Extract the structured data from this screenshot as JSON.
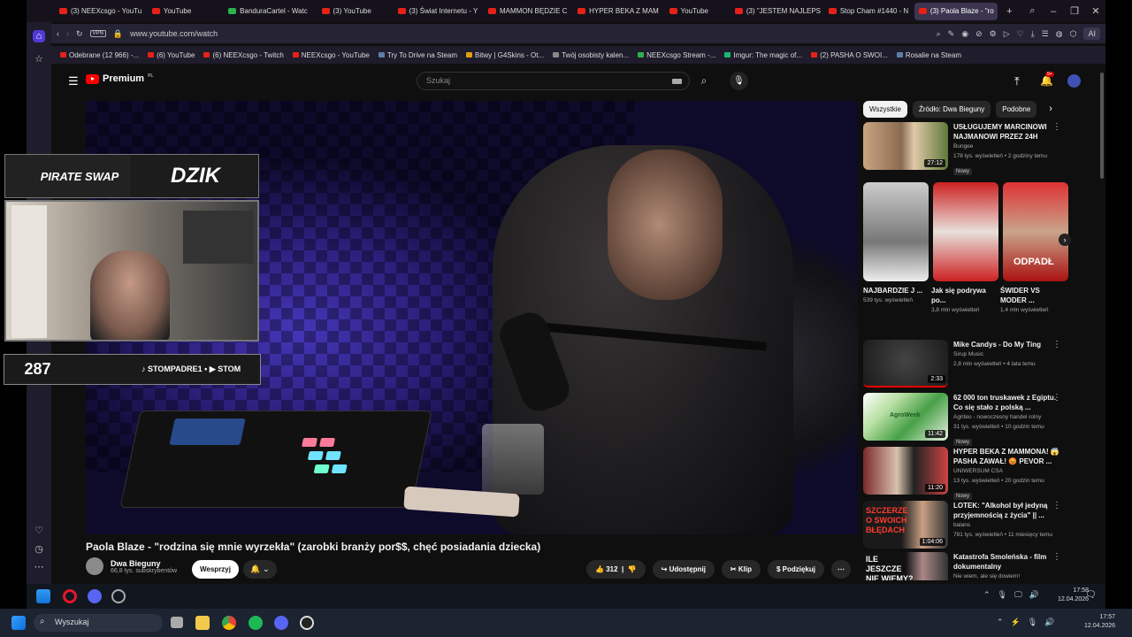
{
  "browser": {
    "tabs": [
      {
        "label": "(3) NEEXcsgo - YouTu",
        "fav": "youtube"
      },
      {
        "label": "YouTube",
        "fav": "youtube"
      },
      {
        "label": "BandurаCartel - Watc",
        "fav": "kick"
      },
      {
        "label": "(3) YouTube",
        "fav": "youtube"
      },
      {
        "label": "(3) Świat Internetu - Y",
        "fav": "youtube"
      },
      {
        "label": "MAMMON BĘDZIE C",
        "fav": "youtube"
      },
      {
        "label": "HYPER BEKA Z MAM",
        "fav": "youtube"
      },
      {
        "label": "YouTube",
        "fav": "youtube"
      },
      {
        "label": "(3) \"JESTEM NAJLEPS",
        "fav": "youtube"
      },
      {
        "label": "Stop Cham #1440 - N",
        "fav": "youtube"
      },
      {
        "label": "(3) Paola Blaze - \"ro",
        "fav": "youtube",
        "active": true
      }
    ],
    "url": "www.youtube.com/watch",
    "vpn_label": "VPN",
    "ai_label": "AI",
    "bookmarks": [
      "Odebrane (12 966) -...",
      "(6) YouTube",
      "(6) NEEXcsgo - Twitch",
      "NEEXcsgo - YouTube",
      "Try To Drive na Steam",
      "Bitwy | G4Skins - Ot...",
      "Twój osobisty kalen...",
      "NEEXcsgo Stream -...",
      "Imgur: The magic of...",
      "(2) PASHA O SWOI...",
      "Rosalie na Steam"
    ]
  },
  "youtube": {
    "logo_text": "Premium",
    "logo_region": "PL",
    "search_placeholder": "Szukaj",
    "notification_count": "9+",
    "video_title": "Paola Blaze - \"rodzina się mnie wyrzekła\" (zarobki branży por$$, chęć posiadania dziecka)",
    "channel_name": "Dwa Bieguny",
    "channel_subs": "66,8 tys. subskrybentów",
    "join_label": "Wesprzyj",
    "bell_label": "🔔 ⌄",
    "actions": {
      "likes": "312",
      "share": "Udostępnij",
      "clip": "Klip",
      "thanks": "Podziękuj"
    },
    "chips": [
      "Wszystkie",
      "Źródło: Dwa Bieguny",
      "Podobne"
    ],
    "recommendations": [
      {
        "title": "USŁUGUJEMY MARCINOWI NAJMANOWI PRZEZ 24H",
        "channel": "Bungee",
        "meta": "178 tys. wyświetleń • 2 godziny temu",
        "duration": "27:12",
        "badge": "Nowy"
      },
      {
        "title": "Mike Candys - Do My Ting",
        "channel": "Sirup Music",
        "meta": "2,8 mln wyświetleń • 4 lata temu",
        "duration": "2:33",
        "badge": ""
      },
      {
        "title": "62 000 ton truskawek z Egiptu. Co się stało z polską ...",
        "channel": "Agriteo - nowoczesny handel rolny",
        "meta": "31 tys. wyświetleń • 10 godzin temu",
        "duration": "11:42",
        "badge": "Nowy"
      },
      {
        "title": "HYPER BEKA Z MAMMONA! 😱 PASHA ZAWAŁ! 😡 PEVOR ...",
        "channel": "UNIWERSUM CSA",
        "meta": "13 tys. wyświetleń • 20 godzin temu",
        "duration": "11:20",
        "badge": "Nowy"
      },
      {
        "title": "LOTEK: \"Alkohol był jedyną przyjemnością z życia\" || ...",
        "channel": "balans",
        "meta": "781 tys. wyświetleń • 11 miesięcy temu",
        "duration": "1:04:06",
        "badge": ""
      },
      {
        "title": "Katastrofa Smoleńska - film dokumentalny",
        "channel": "Nie wiem, ale się dowiem!",
        "meta": "",
        "duration": "",
        "badge": ""
      }
    ],
    "shorts": [
      {
        "title": "NAJBARDZIE J ...",
        "views": "539 tys. wyświetleń"
      },
      {
        "title": "Jak się podrywa po...",
        "views": "3,8 mln wyświetleń"
      },
      {
        "title": "ŚWIDER VS MODER ...",
        "views": "1,4 mln wyświetleń",
        "caption": "ODPADŁ"
      }
    ],
    "thumb_texts": {
      "rec4": "SZCZERZE O SWOICH BŁĘDACH",
      "rec5": "ILE JESZCZE NIE WIEMY?",
      "agroweek": "AgroWeek"
    }
  },
  "overlay": {
    "sponsor1": "PIRATE SWAP",
    "sponsor2": "DZIK",
    "counter": "287",
    "socials": "♪ STOMPADRE1 • ▶ STOM"
  },
  "tray_inner": {
    "time": "17:58",
    "date": "12.04.2026"
  },
  "taskbar": {
    "search": "Wyszukaj",
    "time": "17:57",
    "date": "12.04.2026"
  },
  "colors": {
    "yt_red": "#ff0000",
    "opera_red": "#e3172c",
    "accent_tab": "#3b3550"
  }
}
